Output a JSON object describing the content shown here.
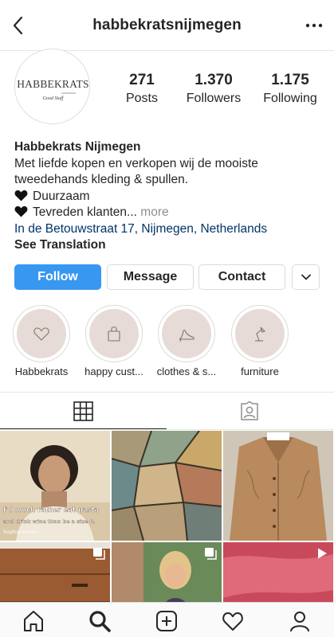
{
  "header": {
    "username": "habbekratsnijmegen"
  },
  "profile": {
    "avatar_logo_main": "HABBEKRATS",
    "avatar_logo_sub": "Good Stuff",
    "stats": [
      {
        "value": "271",
        "label": "Posts"
      },
      {
        "value": "1.370",
        "label": "Followers"
      },
      {
        "value": "1.175",
        "label": "Following"
      }
    ]
  },
  "bio": {
    "name": "Habbekrats Nijmegen",
    "line1": "Met liefde kopen en verkopen wij de mooiste",
    "line2": "tweedehands kleding & spullen.",
    "line3": "Duurzaam",
    "line4": "Tevreden klanten...",
    "more": " more",
    "location": "In de Betouwstraat 17, Nijmegen, Netherlands",
    "translation": "See Translation"
  },
  "actions": {
    "follow": "Follow",
    "message": "Message",
    "contact": "Contact"
  },
  "highlights": [
    {
      "label": "Habbekrats",
      "icon": "heart-outline-icon"
    },
    {
      "label": "happy cust...",
      "icon": "shopping-bag-icon"
    },
    {
      "label": "clothes & s...",
      "icon": "high-heel-icon"
    },
    {
      "label": "furniture",
      "icon": "desk-lamp-icon"
    }
  ],
  "posts": {
    "post1_caption_a": "I'd much rather eat pasta",
    "post1_caption_b": "and drink wine than be a size 0.",
    "post1_caption_c": "Sophia Loren"
  },
  "colors": {
    "accent": "#3897f0",
    "highlight_bg": "#e6dbd7",
    "link": "#003569"
  }
}
